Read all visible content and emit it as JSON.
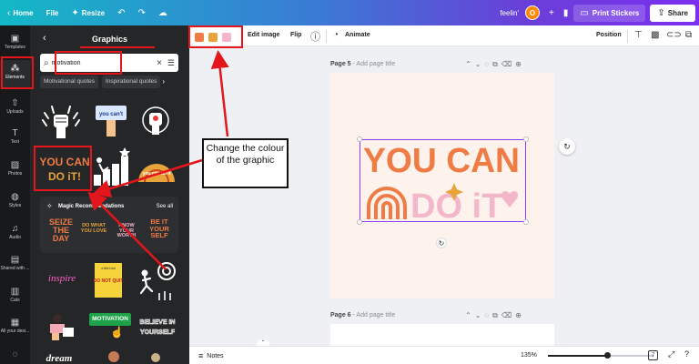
{
  "topbar": {
    "home": "Home",
    "file": "File",
    "resize": "Resize",
    "doc_title": "feelin'",
    "avatar_initial": "O",
    "print": "Print Stickers",
    "share": "Share"
  },
  "rail": {
    "items": [
      "Templates",
      "Elements",
      "Uploads",
      "Text",
      "Photos",
      "Styles",
      "Audio",
      "Shared with ...",
      "Cats",
      "All your desi..."
    ]
  },
  "panel": {
    "title": "Graphics",
    "search_value": "motivation",
    "chips": [
      "Motivational quotes",
      "Inspirational quotes"
    ],
    "thumbs": {
      "you_cant_sign": "you can't",
      "you_can_do_it_line1": "YOU CAN",
      "you_can_do_it_line2": "DO iT!",
      "you_can_do_it_arch": "you can do it",
      "inspire": "inspire",
      "do_not_quit_top": "a little hard",
      "do_not_quit": "DO NOT QUIT",
      "motivation_badge": "MOTIVATION",
      "believe_line1": "BELIEVE IN",
      "believe_line2": "YOURSELF",
      "dream": "dream"
    },
    "magic": {
      "title": "Magic Recommendations",
      "see_all": "See all",
      "words": [
        "SEIZE THE DAY",
        "DO WHAT YOU LOVE",
        "KNOW YOUR WORTH",
        "BE IT YOUR SELF"
      ]
    }
  },
  "ctx": {
    "colors": [
      "#ef7b45",
      "#e8a33a",
      "#f4b6c9"
    ],
    "edit_image": "Edit image",
    "flip": "Flip",
    "animate": "Animate",
    "position": "Position"
  },
  "canvas": {
    "page5_label": "Page 5",
    "page5_sub": "- Add page title",
    "page6_label": "Page 6",
    "page6_sub": "- Add page title",
    "graphic_line1": "YOU CAN",
    "graphic_line2": "DO iT"
  },
  "bottom": {
    "notes": "Notes",
    "zoom": "135%",
    "page_count": "7"
  },
  "annotation": {
    "callout": "Change the colour of the graphic",
    "accent": "#e4161c"
  }
}
